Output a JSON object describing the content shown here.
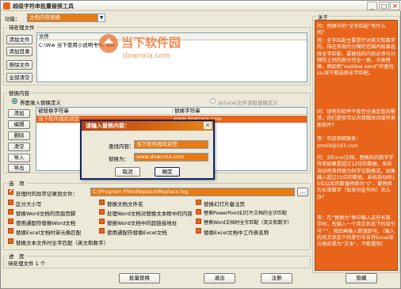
{
  "window": {
    "title": "超级字符串批量替换工具"
  },
  "function_row": {
    "label": "功能：",
    "selected": "文档内容替换"
  },
  "pending_files": {
    "group_title": "待处理文件",
    "buttons": [
      "添加文件",
      "添加目录",
      "移除文件",
      "全部清空"
    ],
    "column_header": "文件",
    "rows": [
      "C:\\Ww 当下使用小说明书%. doc"
    ]
  },
  "replace_content": {
    "group_title": "替换内容",
    "radio_manual": "界面录入替换定义",
    "radio_excel": "从Excel文件读取替换定义",
    "buttons": [
      "添加",
      "编辑",
      "删除",
      "清空",
      "导入",
      "导出"
    ],
    "columns": [
      "被替换字符串",
      "替换字符串"
    ],
    "rows": [
      {
        "from": "当下软件园欢迎您",
        "to": "www.downxia.com"
      }
    ]
  },
  "options": {
    "group_title": "选　项",
    "log_label": "处理时的异常记录到文件：",
    "log_path": "C:\\Program Files\\Replace\\Replace.log",
    "browse": "...",
    "checks": [
      {
        "label": "区分大小写",
        "on": false
      },
      {
        "label": "替换文档文件名",
        "on": false
      },
      {
        "label": "替换幻灯片备注页",
        "on": false
      },
      {
        "label": "替换Word文档的页眉页脚",
        "on": false
      },
      {
        "label": "处理Word文档对替换文本框中的内容",
        "on": false
      },
      {
        "label": "替换PowerPoint幻灯片文档的全字匹配",
        "on": false
      },
      {
        "label": "使用通配符替换Word文档",
        "on": false
      },
      {
        "label": "替换Word文档中的超链接地址",
        "on": false
      },
      {
        "label": "替换Word文档时全字匹配（英文和数字）",
        "on": false
      },
      {
        "label": "替换Excel文档时单元格匹配",
        "on": false
      },
      {
        "label": "使用通配符替换Excel文档",
        "on": false
      },
      {
        "label": "替换Excel文档中工作表名称",
        "on": false
      },
      {
        "label": "替换文本文件时全字匹配（英文和数字）",
        "on": false
      }
    ]
  },
  "progress": {
    "group_title": "进　度",
    "status": "待处理文件 1 个"
  },
  "bottom_buttons": {
    "batch": "批量替换",
    "exit": "退出",
    "register": "注册"
  },
  "sidebar": {
    "title": "关于",
    "faq": [
      "问：替换中的“全字匹配”有什么用？",
      "答：全字匹配主要是针对英文和数字的，指在有效的分隔符范围内如果选择全字匹配，要被找的内容必须与分隔符之间的部分完全一致，才被替换，例如把“saddow sand”中查找sa,就不能选择全字匹配。",
      "问：现有的软件不能完全满足我的需求，你们是否可以为我做改动或开发新软件？",
      "答：欢迎来邮联系：",
      "zmold@163.com",
      "问：对Excel文档，替换后的数字字符串如果是超过12位的数据，系统自动将其转换为科学记数格式。如果输入超过15位的数值，系统自动将15位以后的数值转换为“0”，要替换为长串数字（如身份证号码）怎么办？",
      "答：在“替换为”框中输入这些长数字时，先输入一个英文状态下的单引号“'”，然后再输入数值即可。（输入的英文状态下的单引号告诉Excel单元格应视为“文本”，不能看到）"
    ],
    "hide_button": "隐藏"
  },
  "dialog": {
    "title": "请输入替换内容：",
    "find_label": "查找内容：",
    "find_value": "当下软件园欢迎您",
    "replace_label": "替换为：",
    "replace_value": "www.downxia.com",
    "cancel": "取消",
    "ok": "确定",
    "close": "×"
  },
  "watermark": {
    "cn": "当下软件园",
    "en": "downxia.com"
  }
}
